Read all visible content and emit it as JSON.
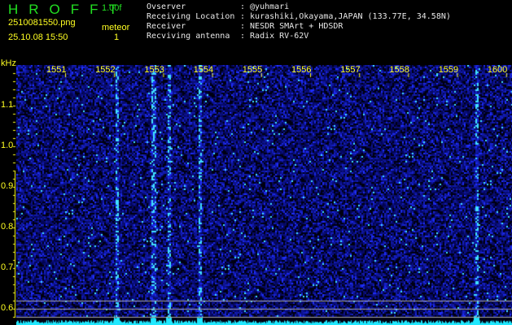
{
  "header": {
    "app_title": "HROFFT",
    "version": "1.00f",
    "filename": "2510081550.png",
    "datetime": "25.10.08 15:50",
    "mode_label": "meteor",
    "count": "1",
    "info_labels": [
      "Ovserver",
      "Receiving Location",
      "Receiver",
      "Recviving antenna"
    ],
    "info_values": [
      ": @yuhmari",
      ": kurashiki,Okayama,JAPAN (133.77E, 34.58N)",
      ": NESDR SMArt + HDSDR",
      ": Radix RV-62V"
    ]
  },
  "spectrogram": {
    "unit": "kHz",
    "x_ticks": [
      "1551",
      "1552",
      "1553",
      "1554",
      "1555",
      "1556",
      "1557",
      "1558",
      "1559",
      "1600"
    ],
    "y_ticks": [
      "1.1",
      "1.0",
      "0.9",
      "0.8",
      "0.7",
      "0.6"
    ],
    "colors": {
      "background": "#000010",
      "signal": "#2030ff",
      "peak": "#20ffff",
      "axis": "#ffff22"
    }
  }
}
